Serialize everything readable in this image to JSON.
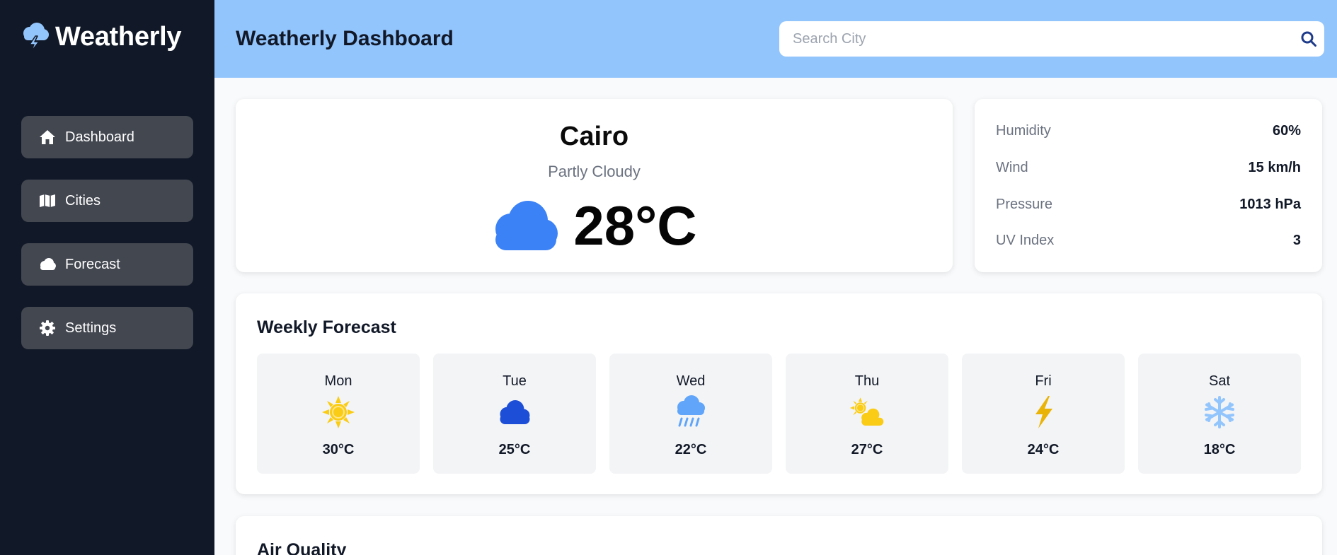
{
  "app": {
    "name": "Weatherly",
    "brand_icon": "cloud-lightning-icon"
  },
  "sidebar": {
    "items": [
      {
        "label": "Dashboard",
        "icon": "home-icon"
      },
      {
        "label": "Cities",
        "icon": "map-icon"
      },
      {
        "label": "Forecast",
        "icon": "cloud-icon"
      },
      {
        "label": "Settings",
        "icon": "gear-icon"
      }
    ]
  },
  "header": {
    "title": "Weatherly Dashboard",
    "search_placeholder": "Search City",
    "search_value": ""
  },
  "current": {
    "city": "Cairo",
    "condition": "Partly Cloudy",
    "temperature": "28°C",
    "icon": "cloud-icon"
  },
  "stats": [
    {
      "label": "Humidity",
      "value": "60%"
    },
    {
      "label": "Wind",
      "value": "15 km/h"
    },
    {
      "label": "Pressure",
      "value": "1013 hPa"
    },
    {
      "label": "UV Index",
      "value": "3"
    }
  ],
  "forecast": {
    "title": "Weekly Forecast",
    "days": [
      {
        "day": "Mon",
        "temp": "30°C",
        "icon": "sun-icon"
      },
      {
        "day": "Tue",
        "temp": "25°C",
        "icon": "cloud-icon"
      },
      {
        "day": "Wed",
        "temp": "22°C",
        "icon": "cloud-rain-icon"
      },
      {
        "day": "Thu",
        "temp": "27°C",
        "icon": "cloud-sun-icon"
      },
      {
        "day": "Fri",
        "temp": "24°C",
        "icon": "bolt-icon"
      },
      {
        "day": "Sat",
        "temp": "18°C",
        "icon": "snowflake-icon"
      }
    ]
  },
  "air_quality": {
    "title": "Air Quality"
  },
  "colors": {
    "sidebar_bg": "#111827",
    "nav_item_bg": "#434750",
    "header_bg": "#93c5fd",
    "accent_blue": "#3b82f6",
    "dark_blue": "#1d4ed8",
    "sun_yellow": "#facc15",
    "bolt_yellow": "#eab308",
    "snow_blue": "#93c5fd"
  }
}
